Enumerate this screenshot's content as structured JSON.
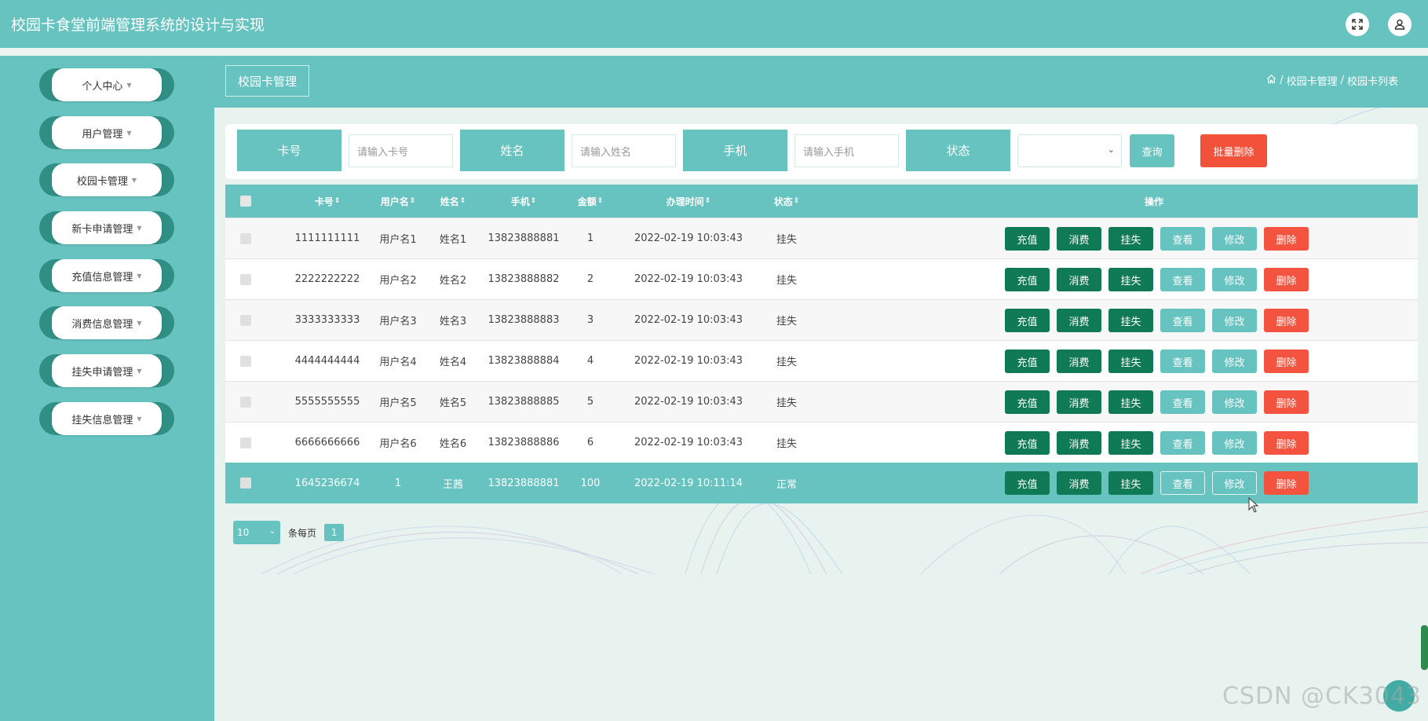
{
  "app": {
    "title": "校园卡食堂前端管理系统的设计与实现"
  },
  "sidebar": {
    "items": [
      {
        "label": "个人中心"
      },
      {
        "label": "用户管理"
      },
      {
        "label": "校园卡管理"
      },
      {
        "label": "新卡申请管理"
      },
      {
        "label": "充值信息管理"
      },
      {
        "label": "消费信息管理"
      },
      {
        "label": "挂失申请管理"
      },
      {
        "label": "挂失信息管理"
      }
    ]
  },
  "topbar": {
    "module_tab": "校园卡管理",
    "breadcrumb": [
      "校园卡管理",
      "校园卡列表"
    ],
    "breadcrumb_sep": "/"
  },
  "search": {
    "card_label": "卡号",
    "card_placeholder": "请输入卡号",
    "name_label": "姓名",
    "name_placeholder": "请输入姓名",
    "phone_label": "手机",
    "phone_placeholder": "请输入手机",
    "status_label": "状态",
    "status_value": "",
    "query_button": "查询",
    "batch_delete_button": "批量删除"
  },
  "table": {
    "columns": [
      "卡号",
      "用户名",
      "姓名",
      "手机",
      "金额",
      "办理时间",
      "状态",
      "操作"
    ],
    "sort_glyph": "⇕",
    "actions": [
      "充值",
      "消费",
      "挂失",
      "查看",
      "修改",
      "删除"
    ],
    "rows": [
      {
        "card": "1111111111",
        "user": "用户名1",
        "name": "姓名1",
        "phone": "13823888881",
        "amount": "1",
        "time": "2022-02-19 10:03:43",
        "status": "挂失"
      },
      {
        "card": "2222222222",
        "user": "用户名2",
        "name": "姓名2",
        "phone": "13823888882",
        "amount": "2",
        "time": "2022-02-19 10:03:43",
        "status": "挂失"
      },
      {
        "card": "3333333333",
        "user": "用户名3",
        "name": "姓名3",
        "phone": "13823888883",
        "amount": "3",
        "time": "2022-02-19 10:03:43",
        "status": "挂失"
      },
      {
        "card": "4444444444",
        "user": "用户名4",
        "name": "姓名4",
        "phone": "13823888884",
        "amount": "4",
        "time": "2022-02-19 10:03:43",
        "status": "挂失"
      },
      {
        "card": "5555555555",
        "user": "用户名5",
        "name": "姓名5",
        "phone": "13823888885",
        "amount": "5",
        "time": "2022-02-19 10:03:43",
        "status": "挂失"
      },
      {
        "card": "6666666666",
        "user": "用户名6",
        "name": "姓名6",
        "phone": "13823888886",
        "amount": "6",
        "time": "2022-02-19 10:03:43",
        "status": "挂失"
      },
      {
        "card": "1645236674",
        "user": "1",
        "name": "王茜",
        "phone": "13823888881",
        "amount": "100",
        "time": "2022-02-19 10:11:14",
        "status": "正常"
      }
    ]
  },
  "pagination": {
    "page_size": "10",
    "per_page_text": "条每页",
    "current_page": "1"
  },
  "watermark": "CSDN @CK3043",
  "colors": {
    "primary": "#66c3c0",
    "dark_action": "#0f7a55",
    "danger": "#f4533f",
    "sidebar_ring": "#2f8f84"
  },
  "icons": {
    "fullscreen": "fullscreen-icon",
    "user": "user-icon",
    "home": "home-icon"
  }
}
